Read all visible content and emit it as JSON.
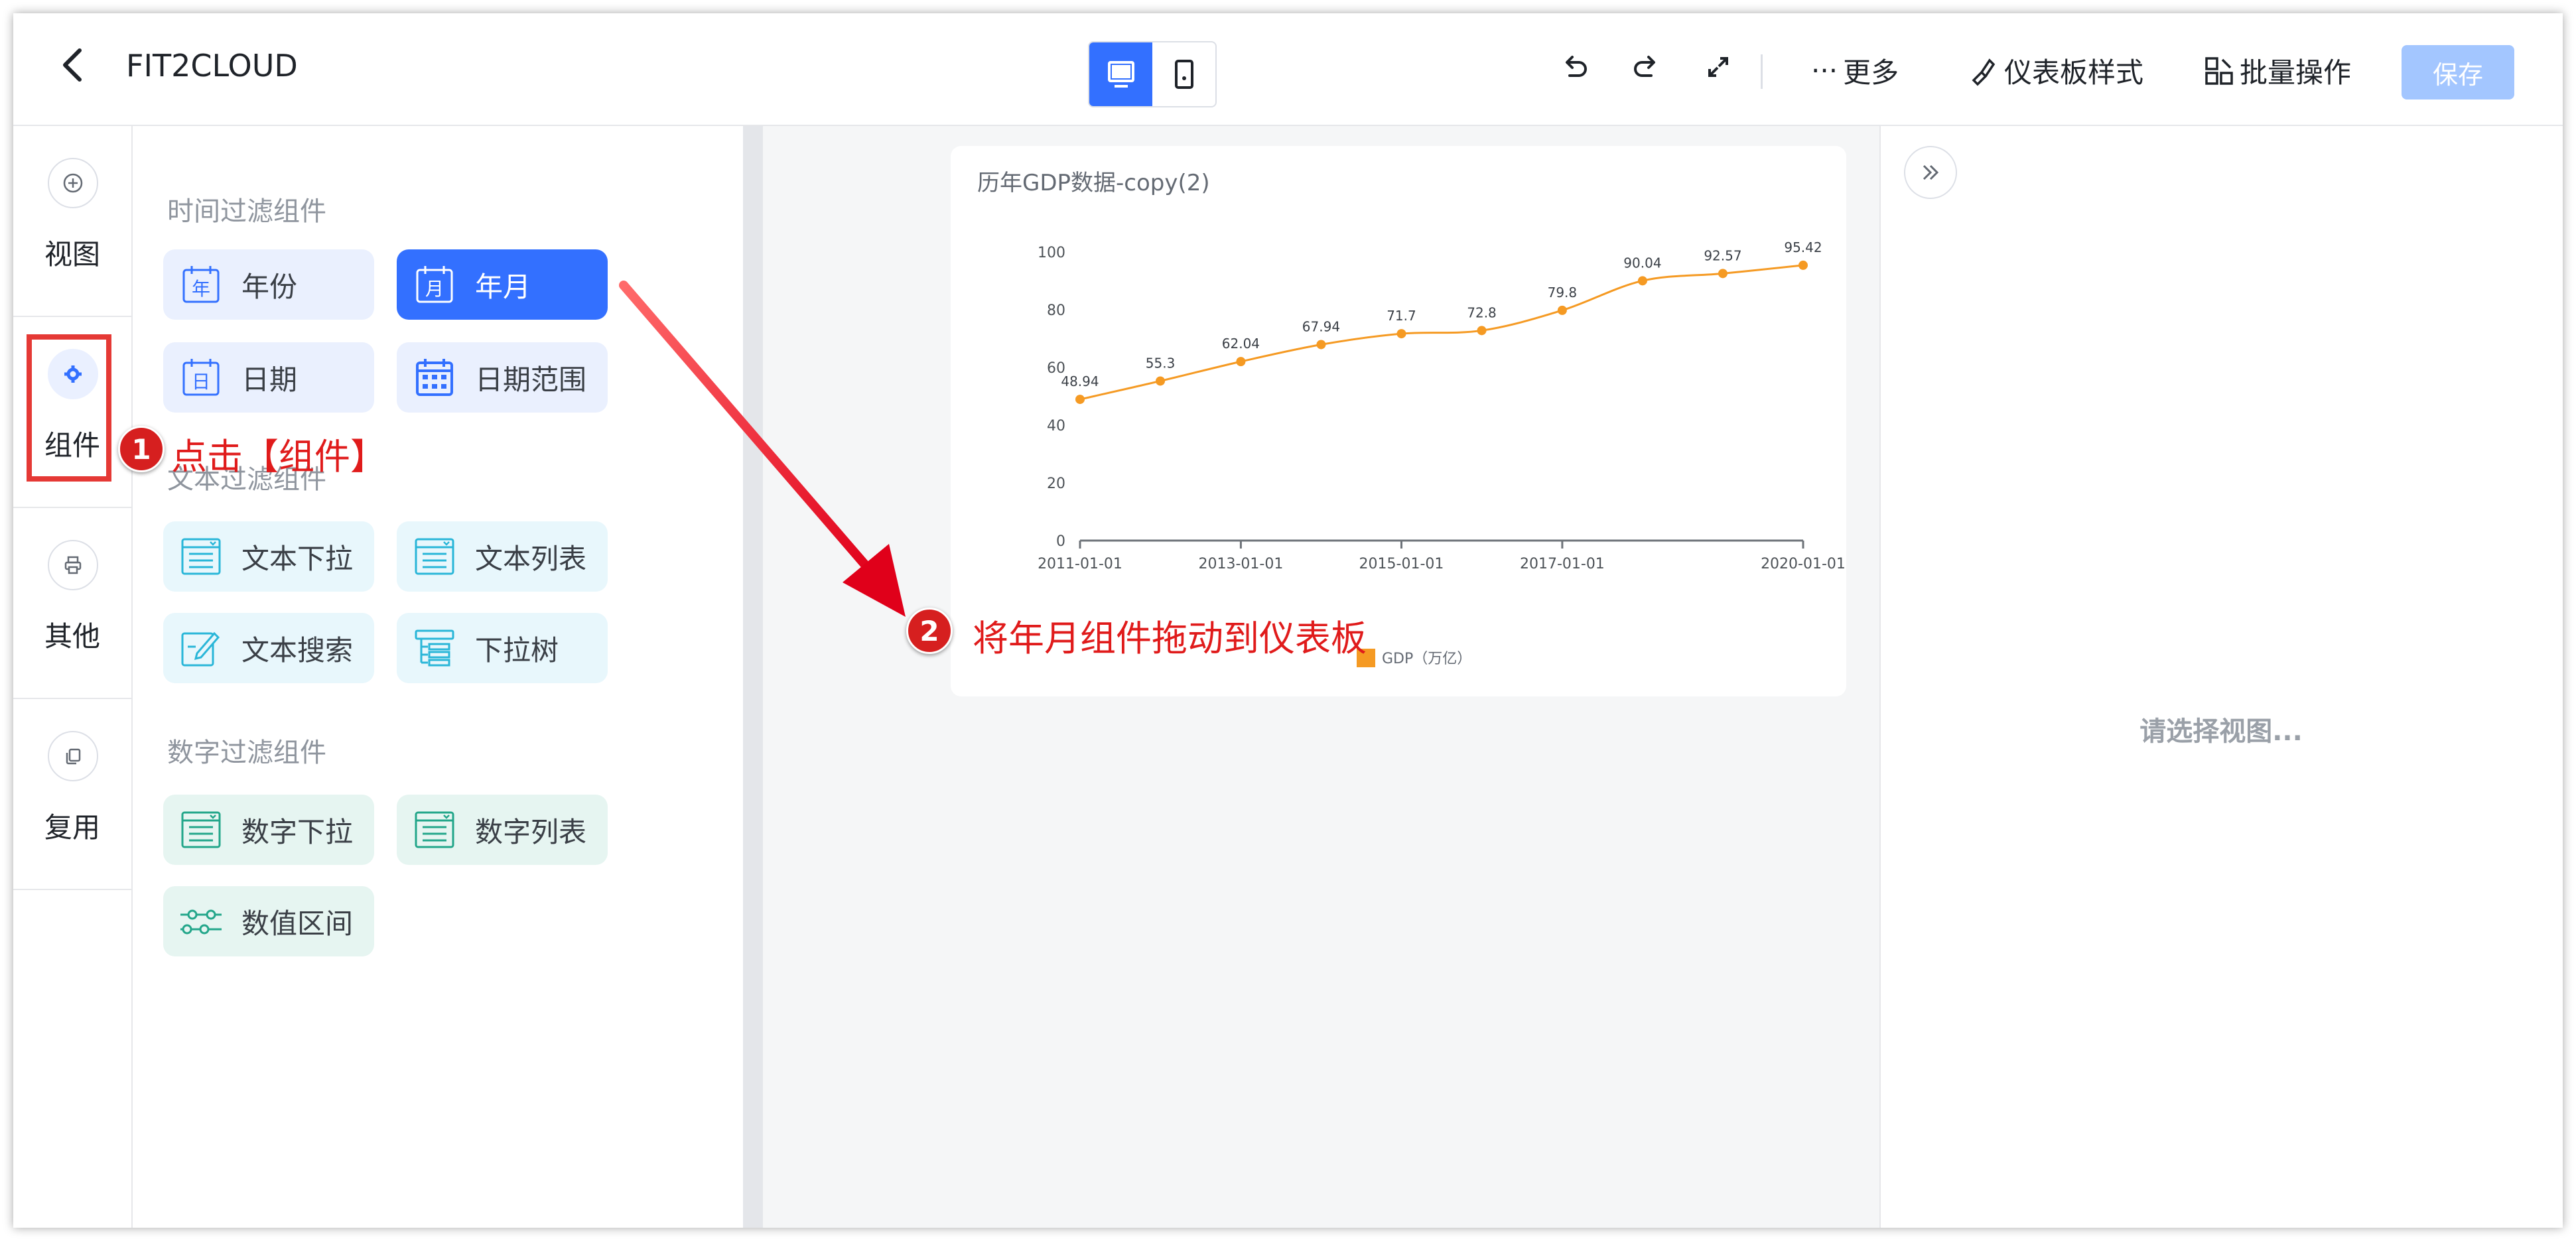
{
  "header": {
    "title": "FIT2CLOUD",
    "more": "更多",
    "dashboard_style": "仪表板样式",
    "batch_ops": "批量操作",
    "save": "保存"
  },
  "rail": {
    "items": [
      {
        "label": "视图",
        "icon": "plus-circle-icon"
      },
      {
        "label": "组件",
        "icon": "gear-icon"
      },
      {
        "label": "其他",
        "icon": "printer-icon"
      },
      {
        "label": "复用",
        "icon": "copy-icon"
      }
    ]
  },
  "panel": {
    "time_section": "时间过滤组件",
    "time_items": [
      {
        "label": "年份",
        "glyph": "年"
      },
      {
        "label": "年月",
        "glyph": "月"
      },
      {
        "label": "日期",
        "glyph": "日"
      },
      {
        "label": "日期范围",
        "glyph": ""
      }
    ],
    "text_section": "文本过滤组件",
    "text_items": [
      {
        "label": "文本下拉"
      },
      {
        "label": "文本列表"
      },
      {
        "label": "文本搜索"
      },
      {
        "label": "下拉树"
      }
    ],
    "num_section": "数字过滤组件",
    "num_items": [
      {
        "label": "数字下拉"
      },
      {
        "label": "数字列表"
      },
      {
        "label": "数值区间"
      }
    ]
  },
  "chart_data": {
    "type": "line",
    "title": "历年GDP数据-copy(2)",
    "x": [
      "2011-01-01",
      "2012-01-01",
      "2013-01-01",
      "2014-01-01",
      "2015-01-01",
      "2016-01-01",
      "2017-01-01",
      "2018-01-01",
      "2019-01-01",
      "2020-01-01"
    ],
    "x_ticks": [
      "2011-01-01",
      "2013-01-01",
      "2015-01-01",
      "2017-01-01",
      "2020-01-01"
    ],
    "series": [
      {
        "name": "GDP（万亿）",
        "values": [
          48.94,
          55.3,
          62.04,
          67.94,
          71.7,
          72.8,
          79.8,
          90.04,
          92.57,
          95.42
        ],
        "color": "#f59a23"
      }
    ],
    "y_ticks": [
      0,
      20,
      40,
      60,
      80,
      100
    ],
    "ylim": [
      0,
      100
    ],
    "legend_position": "bottom"
  },
  "right_panel": {
    "placeholder": "请选择视图..."
  },
  "annotations": {
    "step1_number": "1",
    "step1_text": "点击【组件】",
    "step2_number": "2",
    "step2_text": "将年月组件拖动到仪表板"
  },
  "colors": {
    "primary": "#3370ff",
    "annotation_red": "#e01b1b",
    "series": "#f59a23"
  }
}
